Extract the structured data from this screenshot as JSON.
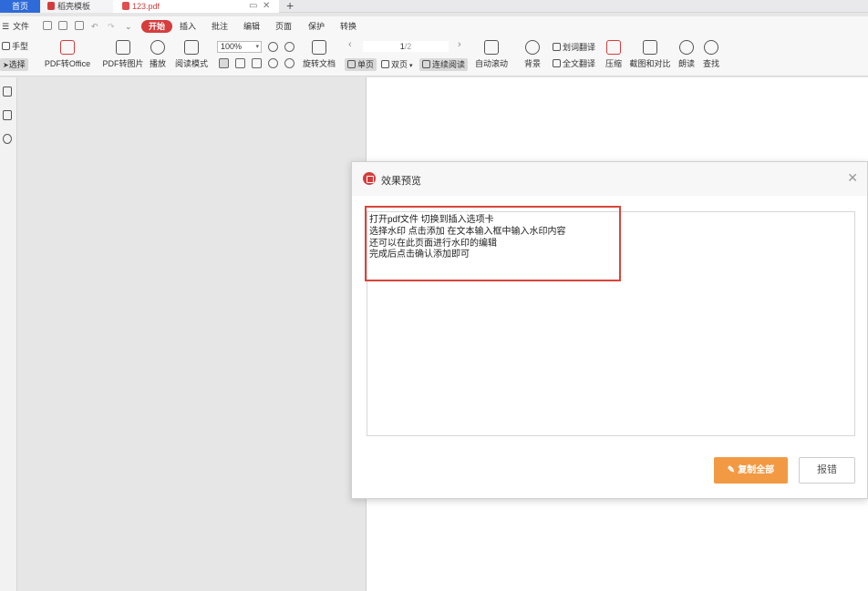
{
  "tabs": {
    "home": "首页",
    "template": "稻壳模板",
    "file": "123.pdf",
    "add": "+"
  },
  "menu": {
    "file": "文件",
    "start": "开始",
    "insert": "插入",
    "annotate": "批注",
    "edit": "编辑",
    "page": "页面",
    "protect": "保护",
    "convert": "转换"
  },
  "ribbon": {
    "hand": "手型",
    "select": "选择",
    "pdf_to_office": "PDF转Office",
    "pdf_to_image": "PDF转图片",
    "play": "播放",
    "read_mode": "阅读模式",
    "zoom": "100%",
    "rotate": "旋转文档",
    "single": "单页",
    "double": "双页",
    "continuous": "连续阅读",
    "auto_scroll": "自动滚动",
    "background": "背景",
    "word_translate": "划词翻译",
    "full_translate": "全文翻译",
    "compress": "压缩",
    "screenshot_compare": "截图和对比",
    "read_aloud": "朗读",
    "find": "查找",
    "page_current": "1",
    "page_total": "/2"
  },
  "dialog": {
    "title": "效果预览",
    "lines": [
      "打开pdf文件 切换到插入选项卡",
      "选择水印 点击添加 在文本输入框中输入水印内容",
      "还可以在此页面进行水印的编辑",
      "完成后点击确认添加即可"
    ],
    "copy_all": "复制全部",
    "report": "报错"
  },
  "colors": {
    "accent_red": "#d63d3d",
    "copy_button": "#f29a43",
    "home_tab": "#2e6bd8",
    "highlight_box": "#d9453a"
  }
}
